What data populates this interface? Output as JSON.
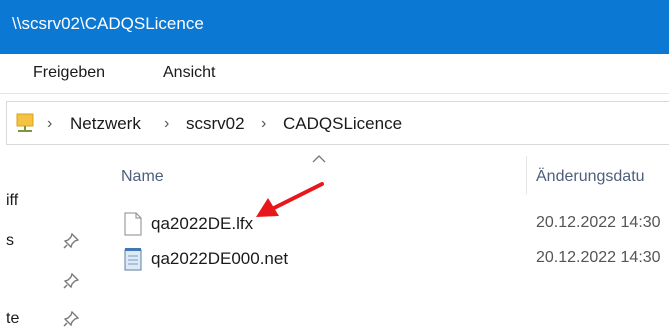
{
  "window": {
    "title": "\\\\scsrv02\\CADQSLicence"
  },
  "ribbon": {
    "tabs": [
      "Freigeben",
      "Ansicht"
    ]
  },
  "address": {
    "crumbs": [
      "Netzwerk",
      "scsrv02",
      "CADQSLicence"
    ]
  },
  "nav_pane": {
    "items": [
      "iff",
      "s",
      "te"
    ]
  },
  "columns": {
    "name": "Name",
    "modified": "Änderungsdatu"
  },
  "files": [
    {
      "name": "qa2022DE.lfx",
      "modified": "20.12.2022 14:30",
      "icon": "generic-file-icon"
    },
    {
      "name": "qa2022DE000.net",
      "modified": "20.12.2022 14:30",
      "icon": "notepad-file-icon"
    }
  ],
  "annotation": {
    "color": "#e8171c",
    "icon": "red-arrow-annotation"
  }
}
